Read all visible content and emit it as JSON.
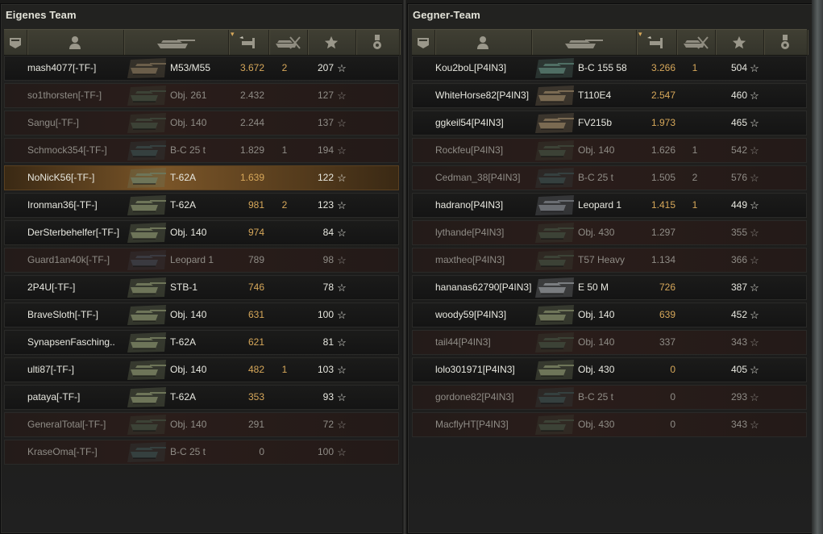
{
  "own_team": {
    "title": "Eigenes Team",
    "players": [
      {
        "name": "mash4077[-TF-]",
        "tank": "M53/M55",
        "damage": "3.672",
        "kills": "2",
        "score": "207",
        "state": "alive",
        "tank_tint": "#6b5e4a"
      },
      {
        "name": "so1thorsten[-TF-]",
        "tank": "Obj. 261",
        "damage": "2.432",
        "kills": "",
        "score": "127",
        "state": "dead",
        "tank_tint": "#3c4236"
      },
      {
        "name": "Sangu[-TF-]",
        "tank": "Obj. 140",
        "damage": "2.244",
        "kills": "",
        "score": "137",
        "state": "dead",
        "tank_tint": "#3c4236"
      },
      {
        "name": "Schmock354[-TF-]",
        "tank": "B-C 25 t",
        "damage": "1.829",
        "kills": "1",
        "score": "194",
        "state": "dead",
        "tank_tint": "#35403f"
      },
      {
        "name": "NoNicK56[-TF-]",
        "tank": "T-62A",
        "damage": "1.639",
        "kills": "",
        "score": "122",
        "state": "self",
        "tank_tint": "#6e7559"
      },
      {
        "name": "Ironman36[-TF-]",
        "tank": "T-62A",
        "damage": "981",
        "kills": "2",
        "score": "123",
        "state": "alive",
        "tank_tint": "#6e7559"
      },
      {
        "name": "DerSterbehelfer[-TF-]",
        "tank": "Obj. 140",
        "damage": "974",
        "kills": "",
        "score": "84",
        "state": "alive",
        "tank_tint": "#6e7559"
      },
      {
        "name": "Guard1an40k[-TF-]",
        "tank": "Leopard 1",
        "damage": "789",
        "kills": "",
        "score": "98",
        "state": "dead",
        "tank_tint": "#3a3a40"
      },
      {
        "name": "2P4U[-TF-]",
        "tank": "STB-1",
        "damage": "746",
        "kills": "",
        "score": "78",
        "state": "alive",
        "tank_tint": "#6e7559"
      },
      {
        "name": "BraveSloth[-TF-]",
        "tank": "Obj. 140",
        "damage": "631",
        "kills": "",
        "score": "100",
        "state": "alive",
        "tank_tint": "#6e7559"
      },
      {
        "name": "SynapsenFasching..",
        "tank": "T-62A",
        "damage": "621",
        "kills": "",
        "score": "81",
        "state": "alive",
        "tank_tint": "#6e7559"
      },
      {
        "name": "ulti87[-TF-]",
        "tank": "Obj. 140",
        "damage": "482",
        "kills": "1",
        "score": "103",
        "state": "alive",
        "tank_tint": "#6e7559"
      },
      {
        "name": "pataya[-TF-]",
        "tank": "T-62A",
        "damage": "353",
        "kills": "",
        "score": "93",
        "state": "alive",
        "tank_tint": "#6e7559"
      },
      {
        "name": "GeneralTotal[-TF-]",
        "tank": "Obj. 140",
        "damage": "291",
        "kills": "",
        "score": "72",
        "state": "dead",
        "tank_tint": "#3c4236"
      },
      {
        "name": "KraseOma[-TF-]",
        "tank": "B-C 25 t",
        "damage": "0",
        "kills": "",
        "score": "100",
        "state": "dead",
        "tank_tint": "#35403f"
      }
    ]
  },
  "enemy_team": {
    "title": "Gegner-Team",
    "players": [
      {
        "name": "Kou2boL[P4IN3]",
        "tank": "B-C 155 58",
        "damage": "3.266",
        "kills": "1",
        "score": "504",
        "state": "alive",
        "tank_tint": "#4f6e64"
      },
      {
        "name": "WhiteHorse82[P4IN3]",
        "tank": "T110E4",
        "damage": "2.547",
        "kills": "",
        "score": "460",
        "state": "alive",
        "tank_tint": "#7a6a52"
      },
      {
        "name": "ggkeil54[P4IN3]",
        "tank": "FV215b",
        "damage": "1.973",
        "kills": "",
        "score": "465",
        "state": "alive",
        "tank_tint": "#7a6a52"
      },
      {
        "name": "Rockfeu[P4IN3]",
        "tank": "Obj. 140",
        "damage": "1.626",
        "kills": "1",
        "score": "542",
        "state": "dead",
        "tank_tint": "#3c4236"
      },
      {
        "name": "Cedman_38[P4IN3]",
        "tank": "B-C 25 t",
        "damage": "1.505",
        "kills": "2",
        "score": "576",
        "state": "dead",
        "tank_tint": "#35403f"
      },
      {
        "name": "hadrano[P4IN3]",
        "tank": "Leopard 1",
        "damage": "1.415",
        "kills": "1",
        "score": "449",
        "state": "alive",
        "tank_tint": "#6a6d72"
      },
      {
        "name": "lythande[P4IN3]",
        "tank": "Obj. 430",
        "damage": "1.297",
        "kills": "",
        "score": "355",
        "state": "dead",
        "tank_tint": "#3c4236"
      },
      {
        "name": "maxtheo[P4IN3]",
        "tank": "T57 Heavy",
        "damage": "1.134",
        "kills": "",
        "score": "366",
        "state": "dead",
        "tank_tint": "#3c4236"
      },
      {
        "name": "hananas62790[P4IN3]",
        "tank": "E 50 M",
        "damage": "726",
        "kills": "",
        "score": "387",
        "state": "alive",
        "tank_tint": "#7a7d80"
      },
      {
        "name": "woody59[P4IN3]",
        "tank": "Obj. 140",
        "damage": "639",
        "kills": "",
        "score": "452",
        "state": "alive",
        "tank_tint": "#6e7559"
      },
      {
        "name": "tail44[P4IN3]",
        "tank": "Obj. 140",
        "damage": "337",
        "kills": "",
        "score": "343",
        "state": "dead",
        "tank_tint": "#3c4236"
      },
      {
        "name": "lolo301971[P4IN3]",
        "tank": "Obj. 430",
        "damage": "0",
        "kills": "",
        "score": "405",
        "state": "alive",
        "tank_tint": "#6e7559"
      },
      {
        "name": "gordone82[P4IN3]",
        "tank": "B-C 25 t",
        "damage": "0",
        "kills": "",
        "score": "293",
        "state": "dead",
        "tank_tint": "#35403f"
      },
      {
        "name": "MacflyHT[P4IN3]",
        "tank": "Obj. 430",
        "damage": "0",
        "kills": "",
        "score": "343",
        "state": "dead",
        "tank_tint": "#3c4236"
      }
    ]
  },
  "header_icons": [
    "squad-icon",
    "player-icon",
    "tank-icon",
    "damage-icon",
    "kills-icon",
    "score-icon",
    "medal-icon"
  ],
  "star_glyph": "☆"
}
